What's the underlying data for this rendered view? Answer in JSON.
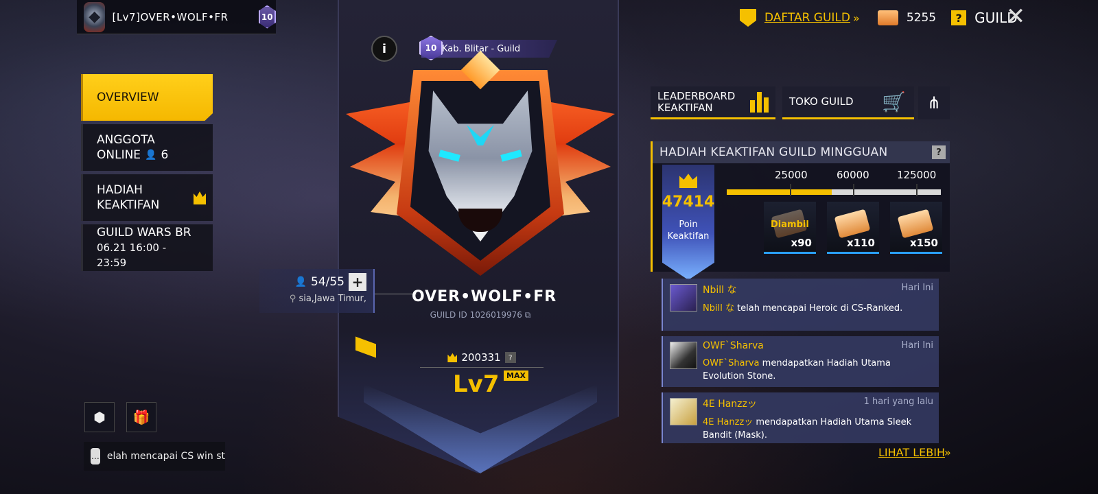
{
  "header": {
    "guild_name": "[Lv7]OVER•WOLF•FR",
    "guild_level": "10"
  },
  "nav": {
    "items": [
      {
        "label_line1": "OVERVIEW",
        "label_line2": ""
      },
      {
        "label_line1": "ANGGOTA",
        "label_line2": "ONLINE",
        "count": "6"
      },
      {
        "label_line1": "HADIAH",
        "label_line2": "KEAKTIFAN"
      },
      {
        "label_line1": "GUILD WARS BR",
        "label_line2": "06.21 16:00 - 23:59"
      }
    ]
  },
  "chat": {
    "preview": "elah mencapai CS win st"
  },
  "banner": {
    "region_level": "10",
    "region": "Kab. Blitar - Guild",
    "info_icon": "i",
    "members": "54/55",
    "location": "sia,Jawa Timur,",
    "guild_name": "OVER•WOLF•FR",
    "guild_id": "GUILD ID 1026019976",
    "glory_points": "200331",
    "level": "Lv7",
    "level_max": "MAX"
  },
  "top_right": {
    "daftar_guild": "DAFTAR GUILD",
    "coins": "5255",
    "guild_label": "GUILD",
    "close": "✕"
  },
  "buttons": {
    "leaderboard_line1": "LEADERBOARD",
    "leaderboard_line2": "KEAKTIFAN",
    "toko": "TOKO GUILD"
  },
  "reward": {
    "title": "HADIAH KEAKTIFAN GUILD MINGGUAN",
    "points": "47414",
    "points_label_1": "Poin",
    "points_label_2": "Keaktifan",
    "progress": 0.49,
    "milestones": [
      {
        "value": "25000",
        "qty": "x90",
        "claimed": "Diambil"
      },
      {
        "value": "60000",
        "qty": "x110"
      },
      {
        "value": "125000",
        "qty": "x150"
      }
    ]
  },
  "feed": [
    {
      "name": "Nbill な",
      "time": "Hari Ini",
      "name_in_body": "Nbill な",
      "body": " telah mencapai Heroic di CS-Ranked."
    },
    {
      "name": "OWF`Sharva",
      "time": "Hari Ini",
      "name_in_body": "OWF`Sharva",
      "body": " mendapatkan Hadiah Utama Evolution Stone."
    },
    {
      "name": "4E Hanzzッ",
      "time": "1 hari yang lalu",
      "name_in_body": "4E Hanzzッ",
      "body": " mendapatkan Hadiah Utama Sleek Bandit (Mask)."
    }
  ],
  "lihat_lebih": "LIHAT LEBIH",
  "colors": {
    "accent": "#f5c000",
    "panel": "#12121e",
    "feed_bg": "#343a62"
  }
}
